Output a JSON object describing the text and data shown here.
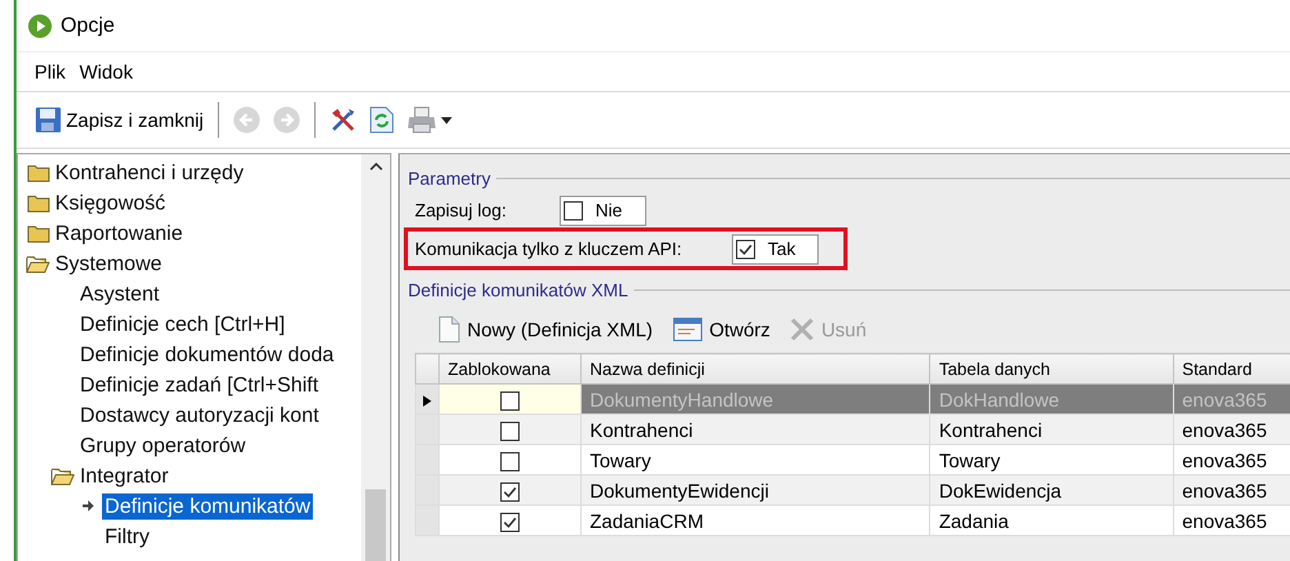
{
  "window": {
    "title": "Opcje"
  },
  "menu": [
    {
      "label": "Plik"
    },
    {
      "label": "Widok"
    }
  ],
  "toolbar": [
    {
      "kind": "save",
      "label": "Zapisz i zamknij",
      "disabled": false
    },
    {
      "kind": "back",
      "disabled": true
    },
    {
      "kind": "forward",
      "disabled": true
    },
    {
      "kind": "tools",
      "disabled": false
    },
    {
      "kind": "refresh",
      "disabled": false
    },
    {
      "kind": "print",
      "disabled": false
    }
  ],
  "tree": [
    {
      "label": "Kontrahenci i urzędy",
      "kind": "folder",
      "expanded": false
    },
    {
      "label": "Księgowość",
      "kind": "folder",
      "expanded": false
    },
    {
      "label": "Raportowanie",
      "kind": "folder",
      "expanded": false
    },
    {
      "label": "Systemowe",
      "kind": "folder",
      "expanded": true,
      "children": [
        {
          "label": "Asystent",
          "kind": "leaf",
          "selected": false
        },
        {
          "label": "Definicje cech [Ctrl+H]",
          "kind": "leaf",
          "selected": false
        },
        {
          "label": "Definicje dokumentów doda",
          "kind": "leaf",
          "selected": false
        },
        {
          "label": "Definicje zadań [Ctrl+Shift",
          "kind": "leaf",
          "selected": false
        },
        {
          "label": "Dostawcy autoryzacji kont",
          "kind": "leaf",
          "selected": false
        },
        {
          "label": "Grupy operatorów",
          "kind": "leaf",
          "selected": false
        },
        {
          "label": "Integrator",
          "kind": "folder",
          "expanded": true,
          "children": [
            {
              "label": "Definicje komunikatów",
              "kind": "leaf",
              "selected": true
            },
            {
              "label": "Filtry",
              "kind": "leaf",
              "selected": false
            }
          ]
        }
      ]
    }
  ],
  "parameters": {
    "title": "Parametry",
    "fields": [
      {
        "label": "Zapisuj log:",
        "checked": false,
        "value": "Nie",
        "highlighted": false
      },
      {
        "label": "Komunikacja tylko z kluczem API:",
        "checked": true,
        "value": "Tak",
        "highlighted": true
      }
    ]
  },
  "definitions": {
    "title": "Definicje komunikatów XML",
    "actions": [
      {
        "kind": "new",
        "label": "Nowy (Definicja XML)",
        "disabled": false
      },
      {
        "kind": "open",
        "label": "Otwórz",
        "disabled": false
      },
      {
        "kind": "delete",
        "label": "Usuń",
        "disabled": true
      }
    ],
    "table": {
      "columns": [
        "Zablokowana",
        "Nazwa definicji",
        "Tabela danych",
        "Standard"
      ],
      "rows": [
        {
          "selected": true,
          "blocked": false,
          "name": "DokumentyHandlowe",
          "table": "DokHandlowe",
          "standard": "enova365"
        },
        {
          "selected": false,
          "blocked": false,
          "name": "Kontrahenci",
          "table": "Kontrahenci",
          "standard": "enova365"
        },
        {
          "selected": false,
          "blocked": false,
          "name": "Towary",
          "table": "Towary",
          "standard": "enova365"
        },
        {
          "selected": false,
          "blocked": true,
          "name": "DokumentyEwidencji",
          "table": "DokEwidencja",
          "standard": "enova365"
        },
        {
          "selected": false,
          "blocked": true,
          "name": "ZadaniaCRM",
          "table": "Zadania",
          "standard": "enova365"
        }
      ]
    }
  }
}
